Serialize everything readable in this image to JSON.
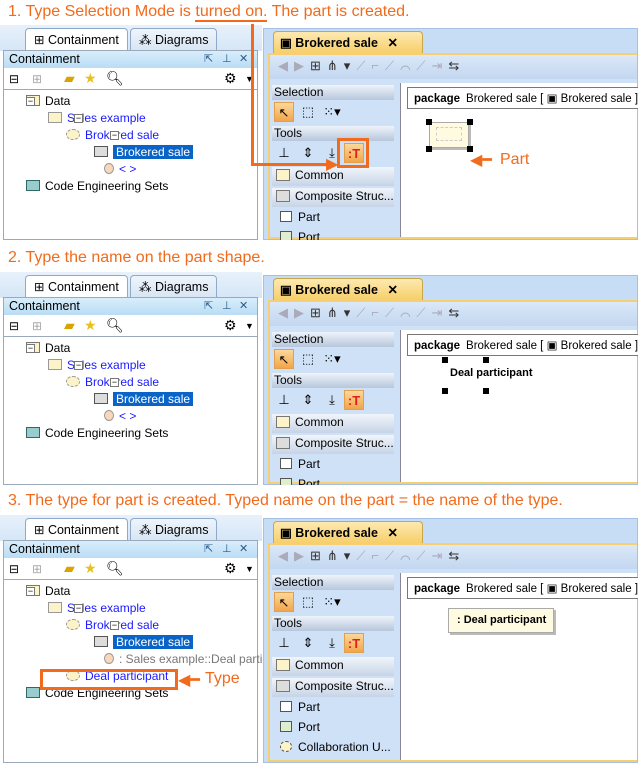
{
  "shared": {
    "containment_tab": "Containment",
    "diagrams_tab": "Diagrams",
    "browser_title": "Containment",
    "diagram_tab": "Brokered sale",
    "close": "✕",
    "palette": {
      "selection": "Selection",
      "tools": "Tools",
      "common": "Common",
      "composite": "Composite Struc...",
      "items": [
        "Part",
        "Port",
        "Collaboration U..."
      ]
    },
    "frame": {
      "keyword": "package",
      "name": "Brokered sale [",
      "inner": "Brokered sale ]"
    }
  },
  "steps": [
    {
      "caption": [
        "1. Type Selection Mode is ",
        "turned on.",
        " The part is created."
      ],
      "tree": [
        "Data",
        "Sales example",
        "Brokered sale",
        "Brokered sale",
        "< >",
        "Code Engineering Sets"
      ],
      "shape_label": "",
      "annotation": "Part"
    },
    {
      "caption": [
        "2. Type the name on the part shape.",
        "",
        ""
      ],
      "tree": [
        "Data",
        "Sales example",
        "Brokered sale",
        "Brokered sale",
        "< >",
        "Code Engineering Sets"
      ],
      "shape_label": "Deal participant",
      "annotation": ""
    },
    {
      "caption": [
        "3. The type for part is created. Typed name on the part = the name of the type.",
        "",
        ""
      ],
      "tree": [
        "Data",
        "Sales example",
        "Brokered sale",
        "Brokered sale",
        ": Sales example::Deal particip",
        "Deal participant",
        "Code Engineering Sets"
      ],
      "shape_label": ": Deal participant",
      "annotation": "Type"
    }
  ],
  "colors": {
    "accent": "#f26a1b",
    "selection": "#0a64c8",
    "link": "#1a1aff"
  }
}
